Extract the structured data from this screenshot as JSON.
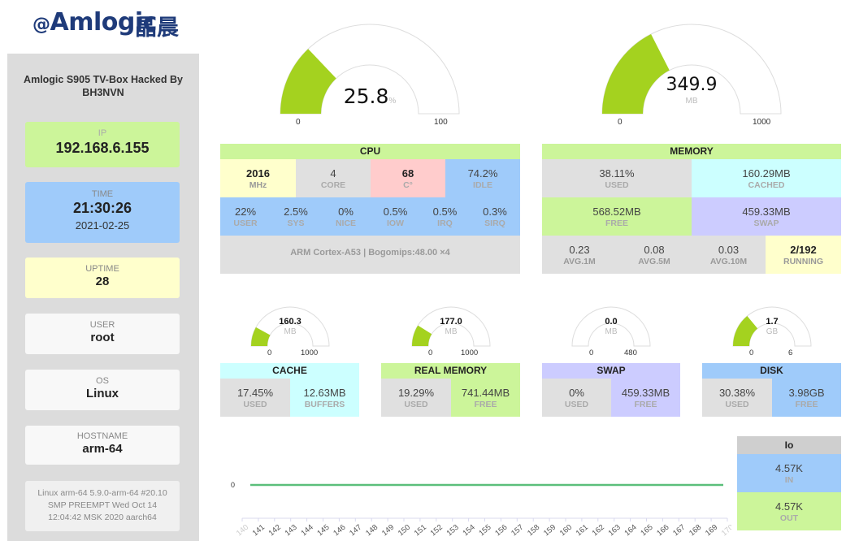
{
  "logo": {
    "brand": "Amlogic",
    "chinese": "晶晨",
    "at": "@"
  },
  "sidebar": {
    "title": "Amlogic S905 TV-Box Hacked By BH3NVN",
    "ip": {
      "label": "IP",
      "value": "192.168.6.155"
    },
    "time": {
      "label": "TIME",
      "value": "21:30:26",
      "date": "2021-02-25"
    },
    "uptime": {
      "label": "UPTIME",
      "value": "28"
    },
    "user": {
      "label": "USER",
      "value": "root"
    },
    "os": {
      "label": "OS",
      "value": "Linux"
    },
    "hostname": {
      "label": "HOSTNAME",
      "value": "arm-64"
    },
    "kernel": "Linux arm-64 5.9.0-arm-64 #20.10 SMP PREEMPT Wed Oct 14 12:04:42 MSK 2020 aarch64"
  },
  "gauges": {
    "cpu": {
      "value": "25.8",
      "unit": "%",
      "min": "0",
      "max": "100",
      "fraction": 0.258
    },
    "memory": {
      "value": "349.9",
      "unit": "MB",
      "min": "0",
      "max": "1000",
      "fraction": 0.35
    },
    "cache": {
      "value": "160.3",
      "unit": "MB",
      "min": "0",
      "max": "1000",
      "fraction": 0.16
    },
    "real_memory": {
      "value": "177.0",
      "unit": "MB",
      "min": "0",
      "max": "1000",
      "fraction": 0.177
    },
    "swap": {
      "value": "0.0",
      "unit": "MB",
      "min": "0",
      "max": "480",
      "fraction": 0.0
    },
    "disk": {
      "value": "1.7",
      "unit": "GB",
      "min": "0",
      "max": "6",
      "fraction": 0.28
    }
  },
  "cpu": {
    "header": "CPU",
    "freq": {
      "value": "2016",
      "unit": "MHz"
    },
    "cores": {
      "value": "4",
      "unit": "CORE"
    },
    "temp": {
      "value": "68",
      "unit": "C°"
    },
    "idle": {
      "value": "74.2%",
      "unit": "IDLE"
    },
    "user": {
      "value": "22%",
      "unit": "USER"
    },
    "sys": {
      "value": "2.5%",
      "unit": "SYS"
    },
    "nice": {
      "value": "0%",
      "unit": "NICE"
    },
    "iow": {
      "value": "0.5%",
      "unit": "IOW"
    },
    "irq": {
      "value": "0.5%",
      "unit": "IRQ"
    },
    "sirq": {
      "value": "0.3%",
      "unit": "SIRQ"
    },
    "model": "ARM Cortex-A53 | Bogomips:48.00 ×4"
  },
  "memory": {
    "header": "MEMORY",
    "used": {
      "value": "38.11%",
      "unit": "USED"
    },
    "cached": {
      "value": "160.29MB",
      "unit": "CACHED"
    },
    "free": {
      "value": "568.52MB",
      "unit": "FREE"
    },
    "swap": {
      "value": "459.33MB",
      "unit": "SWAP"
    },
    "avg1": {
      "value": "0.23",
      "unit": "AVG.1M"
    },
    "avg5": {
      "value": "0.08",
      "unit": "AVG.5M"
    },
    "avg10": {
      "value": "0.03",
      "unit": "AVG.10M"
    },
    "running": {
      "value": "2/192",
      "unit": "RUNNING"
    }
  },
  "cache": {
    "header": "CACHE",
    "used": {
      "value": "17.45%",
      "unit": "USED"
    },
    "buffers": {
      "value": "12.63MB",
      "unit": "BUFFERS"
    }
  },
  "real_memory": {
    "header": "REAL MEMORY",
    "used": {
      "value": "19.29%",
      "unit": "USED"
    },
    "free": {
      "value": "741.44MB",
      "unit": "FREE"
    }
  },
  "swap": {
    "header": "SWAP",
    "used": {
      "value": "0%",
      "unit": "USED"
    },
    "free": {
      "value": "459.33MB",
      "unit": "FREE"
    }
  },
  "disk": {
    "header": "DISK",
    "used": {
      "value": "30.38%",
      "unit": "USED"
    },
    "free": {
      "value": "3.98GB",
      "unit": "FREE"
    }
  },
  "io": {
    "header": "Io",
    "in": {
      "value": "4.57K",
      "unit": "IN"
    },
    "out": {
      "value": "4.57K",
      "unit": "OUT"
    }
  },
  "colors": {
    "gauge_fill": "#a4d21f",
    "green": "#ccf59a",
    "blue": "#9fcbfa",
    "yellow": "#ffffcc",
    "pink": "#ffcccc",
    "cyan": "#ccffff",
    "lavender": "#ccccff",
    "gray": "#e0e0e0",
    "line": "#5bbf7a"
  },
  "chart_data": {
    "type": "line",
    "x": [
      140,
      141,
      142,
      143,
      144,
      145,
      146,
      147,
      148,
      149,
      150,
      151,
      152,
      153,
      154,
      155,
      156,
      157,
      158,
      159,
      160,
      161,
      162,
      163,
      164,
      165,
      166,
      167,
      168,
      169,
      170
    ],
    "y_tick": "0",
    "series": [
      {
        "values": [
          0,
          0,
          0,
          0,
          0,
          0,
          0,
          0,
          0,
          0,
          0,
          0,
          0,
          0,
          0,
          0,
          0,
          0,
          0,
          0,
          0,
          0,
          0,
          0,
          0,
          0,
          0,
          0,
          0,
          0,
          0
        ]
      }
    ]
  }
}
